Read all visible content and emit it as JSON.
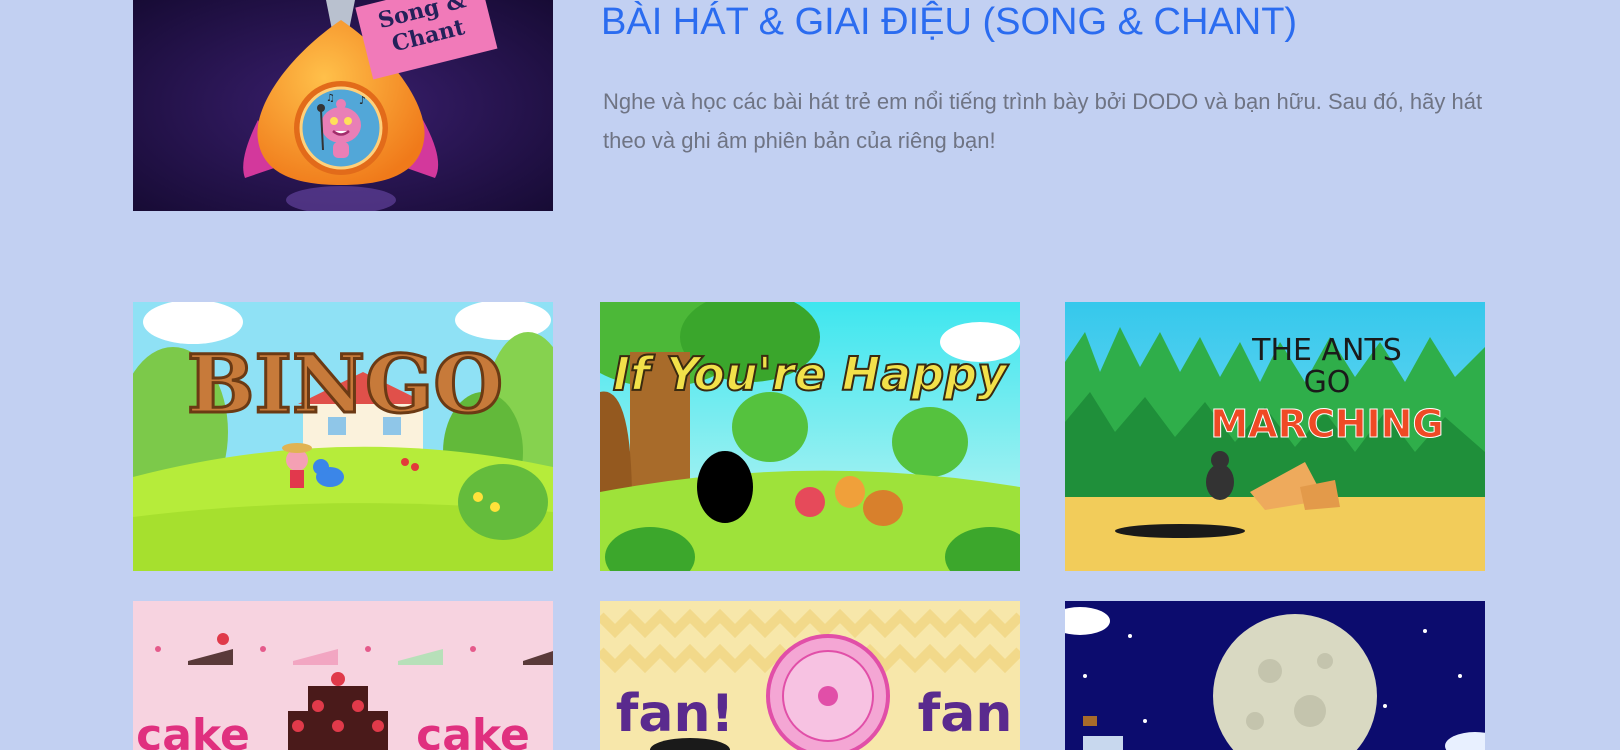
{
  "hero": {
    "title": "BÀI HÁT & GIAI ĐIỆU (SONG & CHANT)",
    "description": "Nghe và học các bài hát trẻ em nổi tiếng trình bày bởi DODO và bạn hữu. Sau đó, hãy hát theo và ghi âm phiên bản của riêng bạn!",
    "image_sign_text": [
      "Song &",
      "Chant"
    ]
  },
  "songs": [
    {
      "title_art": "BINGO"
    },
    {
      "title_art": "If You're Happy"
    },
    {
      "title_art": [
        "THE ANTS",
        "GO",
        "MARCHING"
      ]
    },
    {
      "title_art": [
        "cake",
        "cake"
      ]
    },
    {
      "title_art": [
        "fan!",
        "fan"
      ]
    },
    {
      "title_art": ""
    }
  ],
  "colors": {
    "page_background": "#c2d0f2",
    "title_blue": "#2b6cf0",
    "description_gray": "#6f7484"
  }
}
